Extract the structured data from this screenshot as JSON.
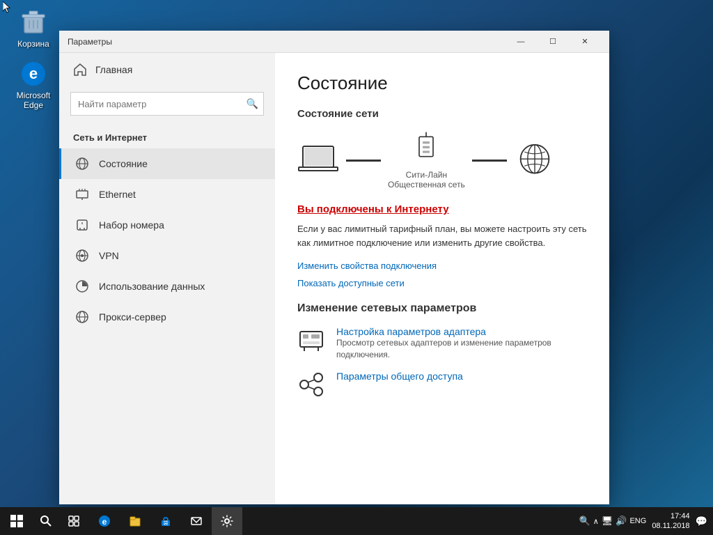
{
  "desktop": {
    "icons": [
      {
        "id": "recycle-bin",
        "label": "Корзина"
      },
      {
        "id": "microsoft-edge",
        "label": "Microsoft Edge"
      }
    ]
  },
  "taskbar": {
    "time": "17:44",
    "date": "08.11.2018",
    "lang": "ENG",
    "items": [
      "start",
      "search",
      "task-view",
      "edge",
      "explorer",
      "store",
      "mail",
      "settings"
    ]
  },
  "window": {
    "title": "Параметры",
    "controls": {
      "minimize": "—",
      "maximize": "☐",
      "close": "✕"
    }
  },
  "sidebar": {
    "home_label": "Главная",
    "search_placeholder": "Найти параметр",
    "section_title": "Сеть и Интернет",
    "items": [
      {
        "id": "status",
        "label": "Состояние",
        "active": true
      },
      {
        "id": "ethernet",
        "label": "Ethernet",
        "active": false
      },
      {
        "id": "dialup",
        "label": "Набор номера",
        "active": false
      },
      {
        "id": "vpn",
        "label": "VPN",
        "active": false
      },
      {
        "id": "data-usage",
        "label": "Использование данных",
        "active": false
      },
      {
        "id": "proxy",
        "label": "Прокси-сервер",
        "active": false
      }
    ]
  },
  "main": {
    "title": "Состояние",
    "network_status_title": "Состояние сети",
    "network_name": "Сити-Лайн",
    "network_type": "Общественная сеть",
    "connected_text": "Вы подключены к Интернету",
    "connected_desc": "Если у вас лимитный тарифный план, вы можете настроить эту сеть как лимитное подключение или изменить другие свойства.",
    "link_properties": "Изменить свойства подключения",
    "link_available": "Показать доступные сети",
    "change_title": "Изменение сетевых параметров",
    "adapter_title": "Настройка параметров адаптера",
    "adapter_desc": "Просмотр сетевых адаптеров и изменение параметров подключения.",
    "sharing_title": "Параметры общего доступа"
  }
}
